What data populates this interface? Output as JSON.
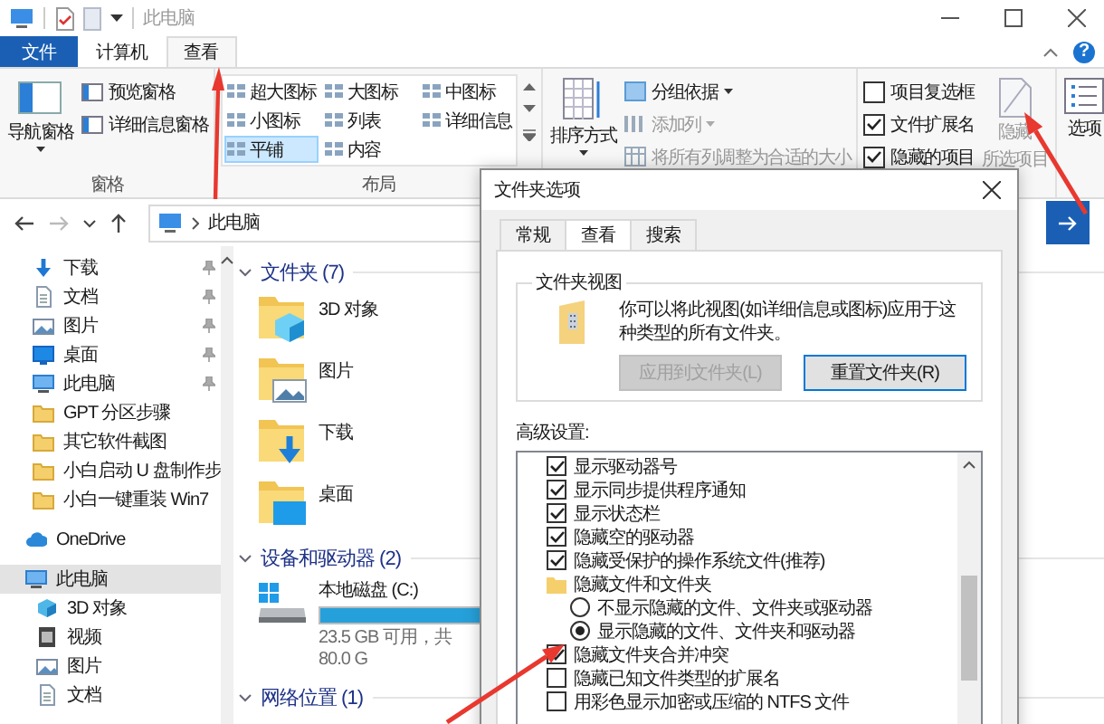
{
  "title_bar": {
    "title": "此电脑"
  },
  "ribbon_tabs": [
    {
      "label": "文件",
      "kind": "file",
      "selected": false
    },
    {
      "label": "计算机",
      "kind": "tab",
      "selected": false
    },
    {
      "label": "查看",
      "kind": "tab",
      "selected": true
    }
  ],
  "help_button": "?",
  "panes_group": {
    "label": "窗格",
    "navigation_pane": "导航窗格",
    "buttons": [
      "预览窗格",
      "详细信息窗格"
    ]
  },
  "layout_group": {
    "label": "布局",
    "options": [
      {
        "label": "超大图标",
        "selected": false
      },
      {
        "label": "大图标",
        "selected": false
      },
      {
        "label": "中图标",
        "selected": false
      },
      {
        "label": "小图标",
        "selected": false
      },
      {
        "label": "列表",
        "selected": false
      },
      {
        "label": "详细信息",
        "selected": false
      },
      {
        "label": "平铺",
        "selected": true
      },
      {
        "label": "内容",
        "selected": false
      }
    ]
  },
  "current_view_group": {
    "sort_by": "排序方式",
    "commands": [
      {
        "label": "分组依据",
        "kind": "group",
        "disabled": false,
        "dropdown": true
      },
      {
        "label": "添加列",
        "kind": "column",
        "disabled": true,
        "dropdown": true
      },
      {
        "label": "将所有列调整为合适的大小",
        "kind": "fit",
        "disabled": true,
        "dropdown": false
      }
    ]
  },
  "show_hide_group": {
    "checkboxes": [
      {
        "label": "项目复选框",
        "checked": false
      },
      {
        "label": "文件扩展名",
        "checked": true
      },
      {
        "label": "隐藏的项目",
        "checked": true
      }
    ],
    "hide_selected": {
      "lines": [
        "隐藏",
        "所选项目"
      ],
      "disabled": true
    }
  },
  "options_button": "选项",
  "address_bar": {
    "path": "此电脑"
  },
  "nav_pane": {
    "quick_access": [
      {
        "label": "下载",
        "kind": "download",
        "pinned": true
      },
      {
        "label": "文档",
        "kind": "doc",
        "pinned": true
      },
      {
        "label": "图片",
        "kind": "picture",
        "pinned": true
      },
      {
        "label": "桌面",
        "kind": "desktop",
        "pinned": true
      },
      {
        "label": "此电脑",
        "kind": "pc",
        "pinned": true
      },
      {
        "label": "GPT 分区步骤",
        "kind": "folder",
        "pinned": false
      },
      {
        "label": "其它软件截图",
        "kind": "folder",
        "pinned": false
      },
      {
        "label": "小白启动 U 盘制作步",
        "kind": "folder",
        "pinned": false
      },
      {
        "label": "小白一键重装 Win7",
        "kind": "folder",
        "pinned": false
      }
    ],
    "tree": [
      {
        "label": "OneDrive",
        "kind": "cloud",
        "selected": false
      },
      {
        "label": "此电脑",
        "kind": "pc",
        "selected": true,
        "children": [
          {
            "label": "3D 对象",
            "kind": "cube",
            "selected": false
          },
          {
            "label": "视频",
            "kind": "video",
            "selected": false
          },
          {
            "label": "图片",
            "kind": "picture",
            "selected": false
          },
          {
            "label": "文档",
            "kind": "doc",
            "selected": false
          }
        ]
      }
    ]
  },
  "content": {
    "sections": [
      {
        "title": "文件夹 (7)",
        "kind": "folders",
        "items": [
          {
            "label": "3D 对象",
            "kind": "cube"
          },
          {
            "label": "图片",
            "kind": "picture"
          },
          {
            "label": "下载",
            "kind": "download"
          },
          {
            "label": "桌面",
            "kind": "desktop"
          }
        ]
      },
      {
        "title": "设备和驱动器 (2)",
        "kind": "drives",
        "items": [
          {
            "label": "本地磁盘 (C:)",
            "level": 0.71,
            "reading": "23.5 GB 可用，共 80.0 G"
          }
        ]
      },
      {
        "title": "网络位置 (1)",
        "kind": "network"
      }
    ]
  },
  "folder_options_dialog": {
    "title": "文件夹选项",
    "tabs": [
      {
        "label": "常规",
        "selected": false
      },
      {
        "label": "查看",
        "selected": true
      },
      {
        "label": "搜索",
        "selected": false
      }
    ],
    "folder_views": {
      "legend": "文件夹视图",
      "text": "你可以将此视图(如详细信息或图标)应用于这种类型的所有文件夹。",
      "buttons": [
        {
          "label": "应用到文件夹(L)",
          "disabled": true
        },
        {
          "label": "重置文件夹(R)",
          "disabled": false
        }
      ]
    },
    "advanced_label": "高级设置:",
    "advanced_settings": [
      {
        "kind": "checkbox",
        "label": "显示驱动器号",
        "checked": true
      },
      {
        "kind": "checkbox",
        "label": "显示同步提供程序通知",
        "checked": true
      },
      {
        "kind": "checkbox",
        "label": "显示状态栏",
        "checked": true
      },
      {
        "kind": "checkbox",
        "label": "隐藏空的驱动器",
        "checked": true
      },
      {
        "kind": "checkbox",
        "label": "隐藏受保护的操作系统文件(推荐)",
        "checked": true
      },
      {
        "kind": "folder",
        "label": "隐藏文件和文件夹"
      },
      {
        "kind": "radio",
        "label": "不显示隐藏的文件、文件夹或驱动器",
        "selected": false
      },
      {
        "kind": "radio",
        "label": "显示隐藏的文件、文件夹和驱动器",
        "selected": true
      },
      {
        "kind": "checkbox",
        "label": "隐藏文件夹合并冲突",
        "checked": true
      },
      {
        "kind": "checkbox",
        "label": "隐藏已知文件类型的扩展名",
        "checked": false
      },
      {
        "kind": "checkbox",
        "label": "用彩色显示加密或压缩的 NTFS 文件",
        "checked": false
      }
    ]
  }
}
